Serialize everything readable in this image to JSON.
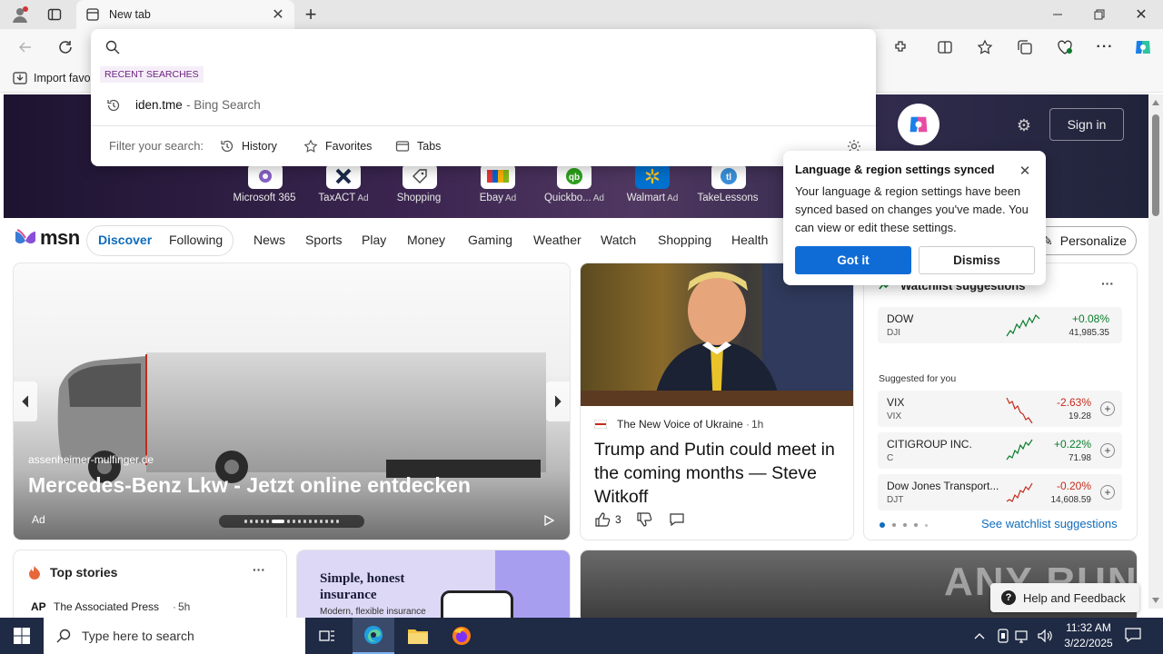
{
  "browser": {
    "tab_title": "New tab",
    "fav_import_label": "Import favo",
    "search_placeholder": ""
  },
  "dropdown": {
    "recent_heading": "RECENT SEARCHES",
    "recent": [
      {
        "query": "iden.tme",
        "source": " - Bing Search"
      }
    ],
    "filter_label": "Filter your search:",
    "filters": [
      "History",
      "Favorites",
      "Tabs"
    ]
  },
  "hero": {
    "sign_in": "Sign in",
    "tiles": [
      {
        "label": "Microsoft 365",
        "ad": ""
      },
      {
        "label": "TaxACT",
        "ad": "Ad"
      },
      {
        "label": "Shopping",
        "ad": ""
      },
      {
        "label": "Ebay",
        "ad": "Ad"
      },
      {
        "label": "Quickbo...",
        "ad": "Ad"
      },
      {
        "label": "Walmart",
        "ad": "Ad"
      },
      {
        "label": "TakeLessons",
        "ad": ""
      }
    ]
  },
  "msn": {
    "logo": "msn",
    "tabs": [
      "Discover",
      "Following"
    ],
    "nav": [
      "News",
      "Sports",
      "Play",
      "Money",
      "Gaming",
      "Weather",
      "Watch",
      "Shopping",
      "Health"
    ],
    "personalize": "Personalize"
  },
  "popup": {
    "title": "Language & region settings synced",
    "body": "Your language & region settings have been synced based on changes you've made. You can view or edit these settings.",
    "got_it": "Got it",
    "dismiss": "Dismiss"
  },
  "ad_card": {
    "source": "assenheimer-mulfinger.de",
    "headline": "Mercedes-Benz Lkw - Jetzt online entdecken",
    "ad_label": "Ad",
    "slide_count": 16,
    "active_slide": 5
  },
  "news_card": {
    "source": "The New Voice of Ukraine",
    "age": "1h",
    "headline": "Trump and Putin could meet in the coming months — Steve Witkoff",
    "likes": "3"
  },
  "watchlist": {
    "title": "Watchlist suggestions",
    "suggested_label": "Suggested for you",
    "see_more": "See watchlist suggestions",
    "stocks": [
      {
        "name": "DOW",
        "ticker": "DJI",
        "change": "+0.08%",
        "price": "41,985.35",
        "up": true
      },
      {
        "name": "VIX",
        "ticker": "VIX",
        "change": "-2.63%",
        "price": "19.28",
        "up": false
      },
      {
        "name": "CITIGROUP INC.",
        "ticker": "C",
        "change": "+0.22%",
        "price": "71.98",
        "up": true
      },
      {
        "name": "Dow Jones Transport...",
        "ticker": "DJT",
        "change": "-0.20%",
        "price": "14,608.59",
        "up": false
      }
    ]
  },
  "top_stories": {
    "title": "Top stories",
    "item_source": "The Associated Press",
    "item_age": "5h",
    "ap_logo": "AP"
  },
  "insurance_ad": {
    "headline": "Simple, honest insurance",
    "sub": "Modern, flexible insurance"
  },
  "bottom": {
    "watermark": "ANY RUN",
    "help": "Help and Feedback"
  },
  "taskbar": {
    "search_placeholder": "Type here to search",
    "time": "11:32 AM",
    "date": "3/22/2025"
  },
  "colors": {
    "accent": "#0f6cbd",
    "button_blue": "#0f6cd6",
    "up_green": "#0a7d2c",
    "down_red": "#c42b1c",
    "taskbar": "#1f2a44"
  }
}
